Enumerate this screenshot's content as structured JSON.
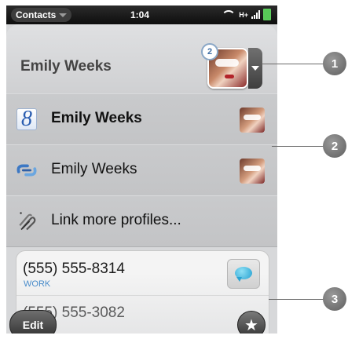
{
  "status_bar": {
    "app_name": "Contacts",
    "time": "1:04",
    "network": "H+"
  },
  "header": {
    "name": "Emily Weeks",
    "linked_count": "2"
  },
  "profiles": [
    {
      "label": "Emily Weeks",
      "icon": "google-icon",
      "icon_text": "8",
      "bold": true
    },
    {
      "label": "Emily Weeks",
      "icon": "synergy-link-icon",
      "bold": false
    },
    {
      "label": "Link more profiles...",
      "icon": "link-profiles-icon",
      "bold": false
    }
  ],
  "phones": [
    {
      "number": "(555) 555-8314",
      "type": "WORK"
    },
    {
      "number": "(555) 555-3082",
      "type": ""
    }
  ],
  "buttons": {
    "edit": "Edit",
    "star": "★"
  },
  "callouts": [
    "1",
    "2",
    "3"
  ],
  "colors": {
    "phone_type": "#3a83c8",
    "battery": "#57c957"
  }
}
